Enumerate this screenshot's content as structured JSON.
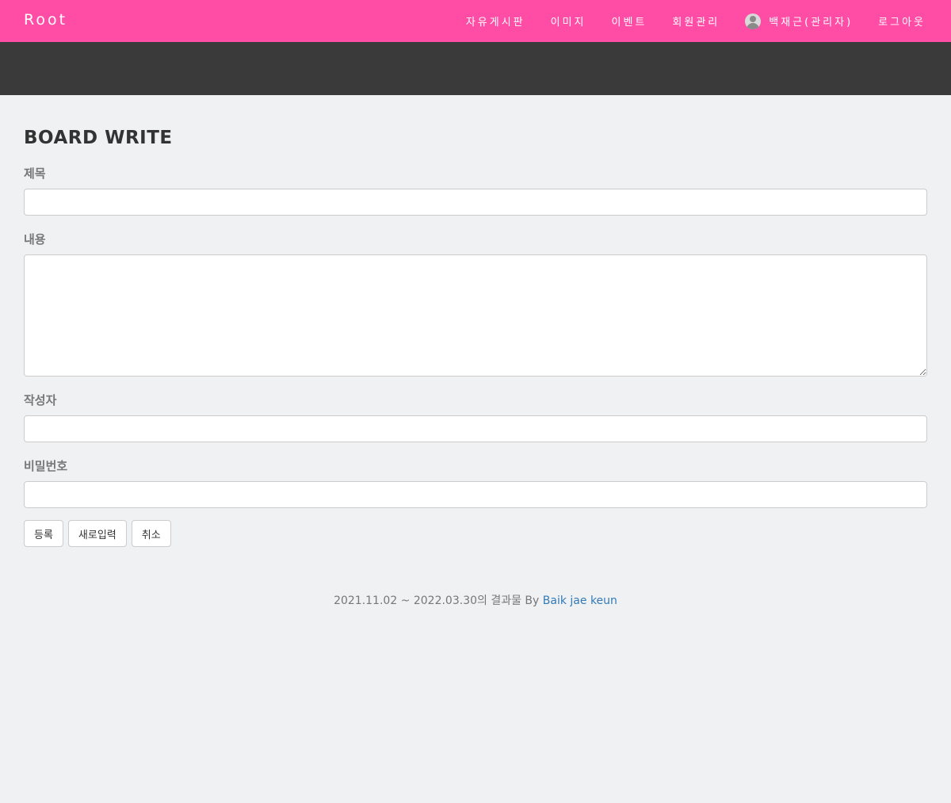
{
  "navbar": {
    "brand": "Root",
    "links": {
      "board": "자유게시판",
      "image": "이미지",
      "event": "이벤트",
      "members": "회원관리",
      "user": "백재근(관리자)",
      "logout": "로그아웃"
    },
    "color": "#ff4da6"
  },
  "form": {
    "heading": "BOARD WRITE",
    "title_label": "제목",
    "title_value": "",
    "content_label": "내용",
    "content_value": "",
    "author_label": "작성자",
    "author_value": "",
    "password_label": "비밀번호",
    "password_value": "",
    "buttons": {
      "submit": "등록",
      "reset": "새로입력",
      "cancel": "취소"
    }
  },
  "footer": {
    "text": "2021.11.02 ~ 2022.03.30의 결과물 By ",
    "author_link": "Baik jae keun"
  }
}
